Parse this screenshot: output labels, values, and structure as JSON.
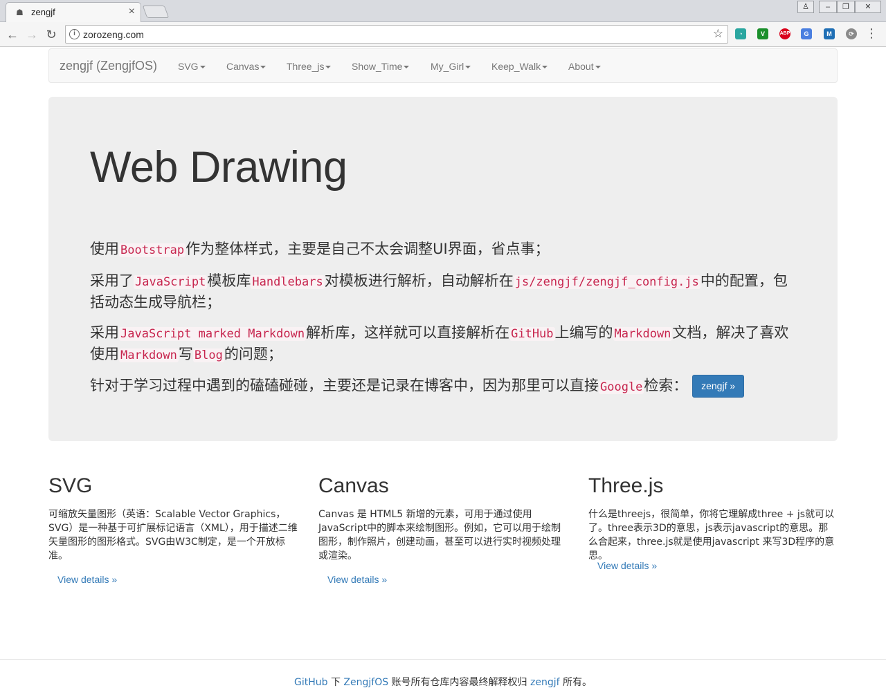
{
  "browser": {
    "tab_title": "zengjf",
    "url": "zorozeng.com",
    "extensions": [
      "V",
      "ABP",
      "G",
      "M"
    ]
  },
  "navbar": {
    "brand": "zengjf (ZengjfOS)",
    "items": [
      "SVG",
      "Canvas",
      "Three_js",
      "Show_Time",
      "My_Girl",
      "Keep_Walk",
      "About"
    ]
  },
  "jumbotron": {
    "title": "Web Drawing",
    "p1": {
      "a": "使用",
      "c1": "Bootstrap",
      "b": "作为整体样式，主要是自己不太会调整UI界面，省点事；"
    },
    "p2": {
      "a": "采用了",
      "c1": "JavaScript",
      "b": "模板库",
      "c2": "Handlebars",
      "c": "对模板进行解析，自动解析在",
      "c3": "js/zengjf/zengjf_config.js",
      "d": "中的配置，包括动态生成导航栏；"
    },
    "p3": {
      "a": "采用",
      "c1": "JavaScript marked Markdown",
      "b": "解析库，这样就可以直接解析在",
      "c2": "GitHub",
      "c": "上编写的",
      "c3": "Markdown",
      "d": "文档，解决了喜欢使用",
      "c4": "Markdown",
      "e": "写",
      "c5": "Blog",
      "f": "的问题；"
    },
    "p4": {
      "a": "针对于学习过程中遇到的磕磕碰碰，主要还是记录在博客中，因为那里可以直接",
      "c1": "Google",
      "b": "检索："
    },
    "button": "zengjf »"
  },
  "columns": [
    {
      "title": "SVG",
      "text": "可缩放矢量图形（英语：Scalable Vector Graphics，SVG）是一种基于可扩展标记语言（XML），用于描述二维矢量图形的图形格式。SVG由W3C制定，是一个开放标准。",
      "link": "View details »"
    },
    {
      "title": "Canvas",
      "text": "Canvas 是 HTML5 新增的元素，可用于通过使用JavaScript中的脚本来绘制图形。例如，它可以用于绘制图形，制作照片，创建动画，甚至可以进行实时视频处理或渲染。",
      "link": "View details »"
    },
    {
      "title": "Three.js",
      "text": "什么是threejs，很简单，你将它理解成three + js就可以了。three表示3D的意思，js表示javascript的意思。那么合起来，three.js就是使用javascript 来写3D程序的意思。",
      "link": "View details »"
    }
  ],
  "footer": {
    "github": "GitHub",
    "mid1": " 下 ",
    "org": "ZengjfOS",
    "mid2": " 账号所有仓库内容最终解释权归 ",
    "owner": "zengjf",
    "end": " 所有。"
  }
}
